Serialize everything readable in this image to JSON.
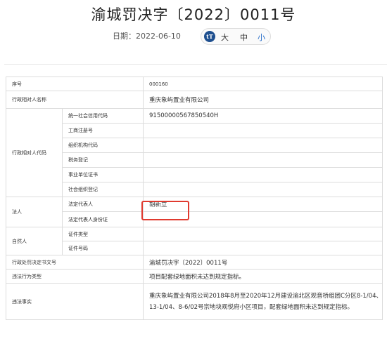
{
  "header": {
    "title": "渝城罚决字〔2022〕0011号",
    "date_label": "日期：2022-06-10",
    "size_icon": "tT",
    "size_large": "大",
    "size_medium": "中",
    "size_small": "小"
  },
  "colors": {
    "accent": "#1e4f8f",
    "highlight": "#e03a2f",
    "border": "#dcdcdc"
  },
  "table": {
    "serial_label": "序号",
    "serial_value": "000160",
    "name_label": "行政相对人名称",
    "name_value": "重庆象屿置业有限公司",
    "code_label": "行政相对人代码",
    "codes": [
      {
        "label": "统一社会信用代码",
        "value": "91500000567850540H"
      },
      {
        "label": "工商注册号",
        "value": ""
      },
      {
        "label": "组织机构代码",
        "value": ""
      },
      {
        "label": "税务登记",
        "value": ""
      },
      {
        "label": "事业单位证书",
        "value": ""
      },
      {
        "label": "社会组织登记",
        "value": ""
      }
    ],
    "legal_label": "法人",
    "legal_rep_label": "法定代表人",
    "legal_rep_value": "胡新立",
    "legal_id_label": "法定代表人身份证",
    "legal_id_value": "",
    "natural_label": "自然人",
    "cert_type_label": "证件类型",
    "cert_type_value": "",
    "cert_no_label": "证件号码",
    "cert_no_value": "",
    "doc_label": "行政处罚决定书文号",
    "doc_value": "渝城罚决字〔2022〕0011号",
    "type_label": "违法行为类型",
    "type_value": "项目配套绿地面积未达到规定指标。",
    "fact_label": "违法事实",
    "fact_value": "重庆象屿置业有限公司2018年8月至2020年12月建设渝北区观音桥组团C分区8-1/04、13-1/04、8-6/02号宗地块观悦府小区项目，配套绿地面积未达到规定指标。"
  }
}
